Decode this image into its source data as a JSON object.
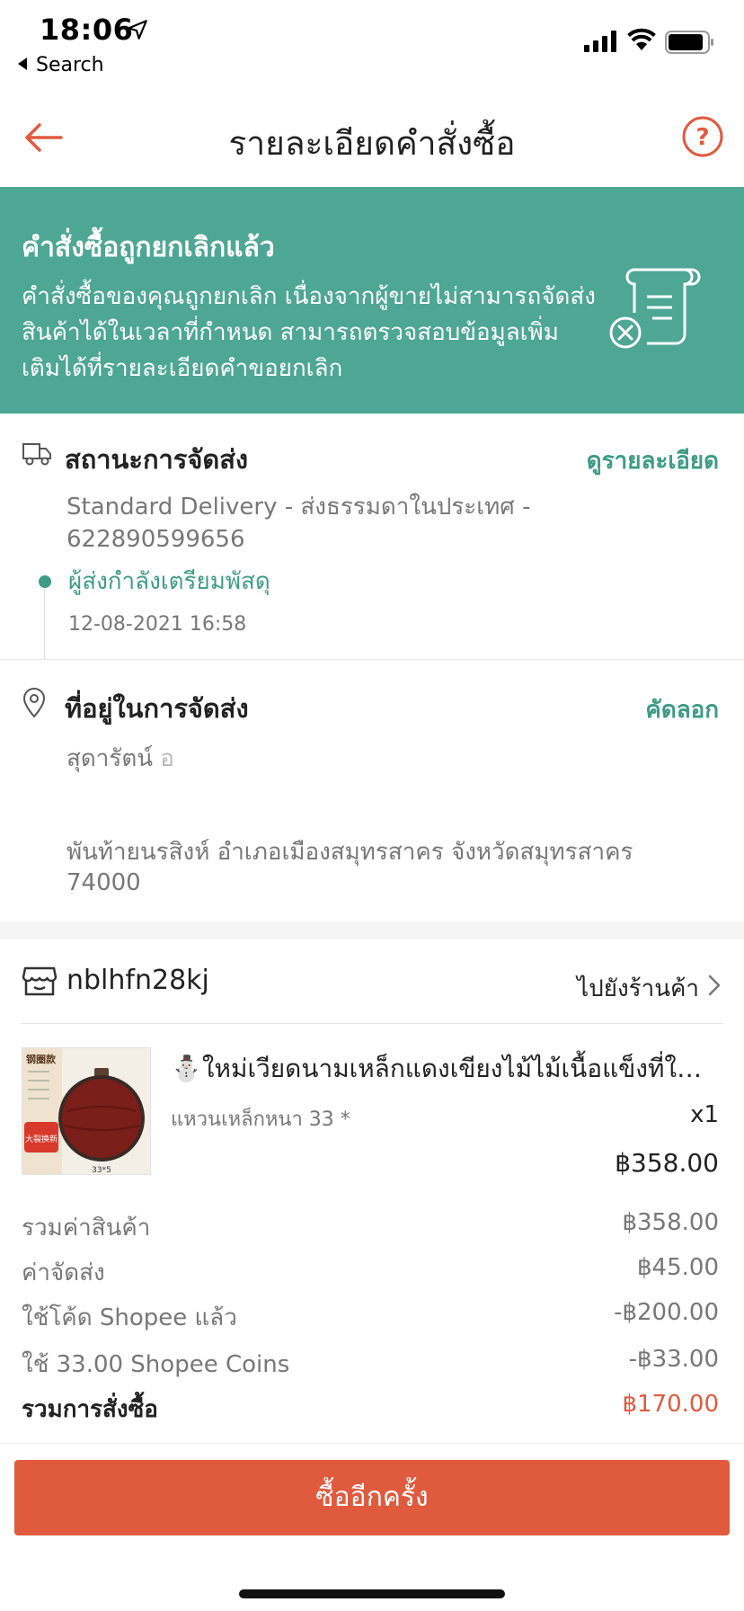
{
  "status_bar": {
    "time": "18:06",
    "back_app": "Search"
  },
  "nav": {
    "title": "รายละเอียดคำสั่งซื้อ"
  },
  "banner": {
    "title": "คำสั่งซื้อถูกยกเลิกแล้ว",
    "text": "คำสั่งซื้อของคุณถูกยกเลิก เนื่องจากผู้ขายไม่สามารถจัดส่งสินค้าได้ในเวลาที่กำหนด สามารถตรวจสอบข้อมูลเพิ่มเติมได้ที่รายละเอียดคำขอยกเลิก"
  },
  "shipping": {
    "title": "สถานะการจัดส่ง",
    "link": "ดูรายละเอียด",
    "method": "Standard Delivery - ส่งธรรมดาในประเทศ - 622890599656",
    "status": "ผู้ส่งกำลังเตรียมพัสดุ",
    "time": "12-08-2021 16:58"
  },
  "address": {
    "title": "ที่อยู่ในการจัดส่ง",
    "link": "คัดลอก",
    "name": "สุดารัตน์ อ",
    "text": "พันท้ายนรสิงห์ อำเภอเมืองสมุทรสาคร จังหวัดสมุทรสาคร 74000"
  },
  "shop": {
    "name": "nblhfn28kj",
    "link": "ไปยังร้านค้า"
  },
  "product": {
    "image_labels": {
      "top": "钢圈款",
      "badge": "大裂换新",
      "size": "33*5"
    },
    "name": "⛄ใหม่เวียดนามเหล็กแดงเขียงไม้ไม้เนื้อแข็งที่ใช้ในครัวเรือน",
    "variant": "แหวนเหล็กหนา 33 *",
    "qty": "x1",
    "price": "฿358.00"
  },
  "summary": {
    "subtotal_label": "รวมค่าสินค้า",
    "subtotal": "฿358.00",
    "shipping_label": "ค่าจัดส่ง",
    "shipping": "฿45.00",
    "voucher_label": "ใช้โค้ด Shopee แล้ว",
    "voucher": "-฿200.00",
    "coins_label": "ใช้ 33.00 Shopee Coins",
    "coins": "-฿33.00",
    "total_label": "รวมการสั่งซื้อ",
    "total": "฿170.00"
  },
  "actions": {
    "rebuy": "ซื้ออีกครั้ง"
  },
  "colors": {
    "accent": "#e05a3e",
    "teal": "#4ea695",
    "teal_text": "#3e9b88"
  }
}
